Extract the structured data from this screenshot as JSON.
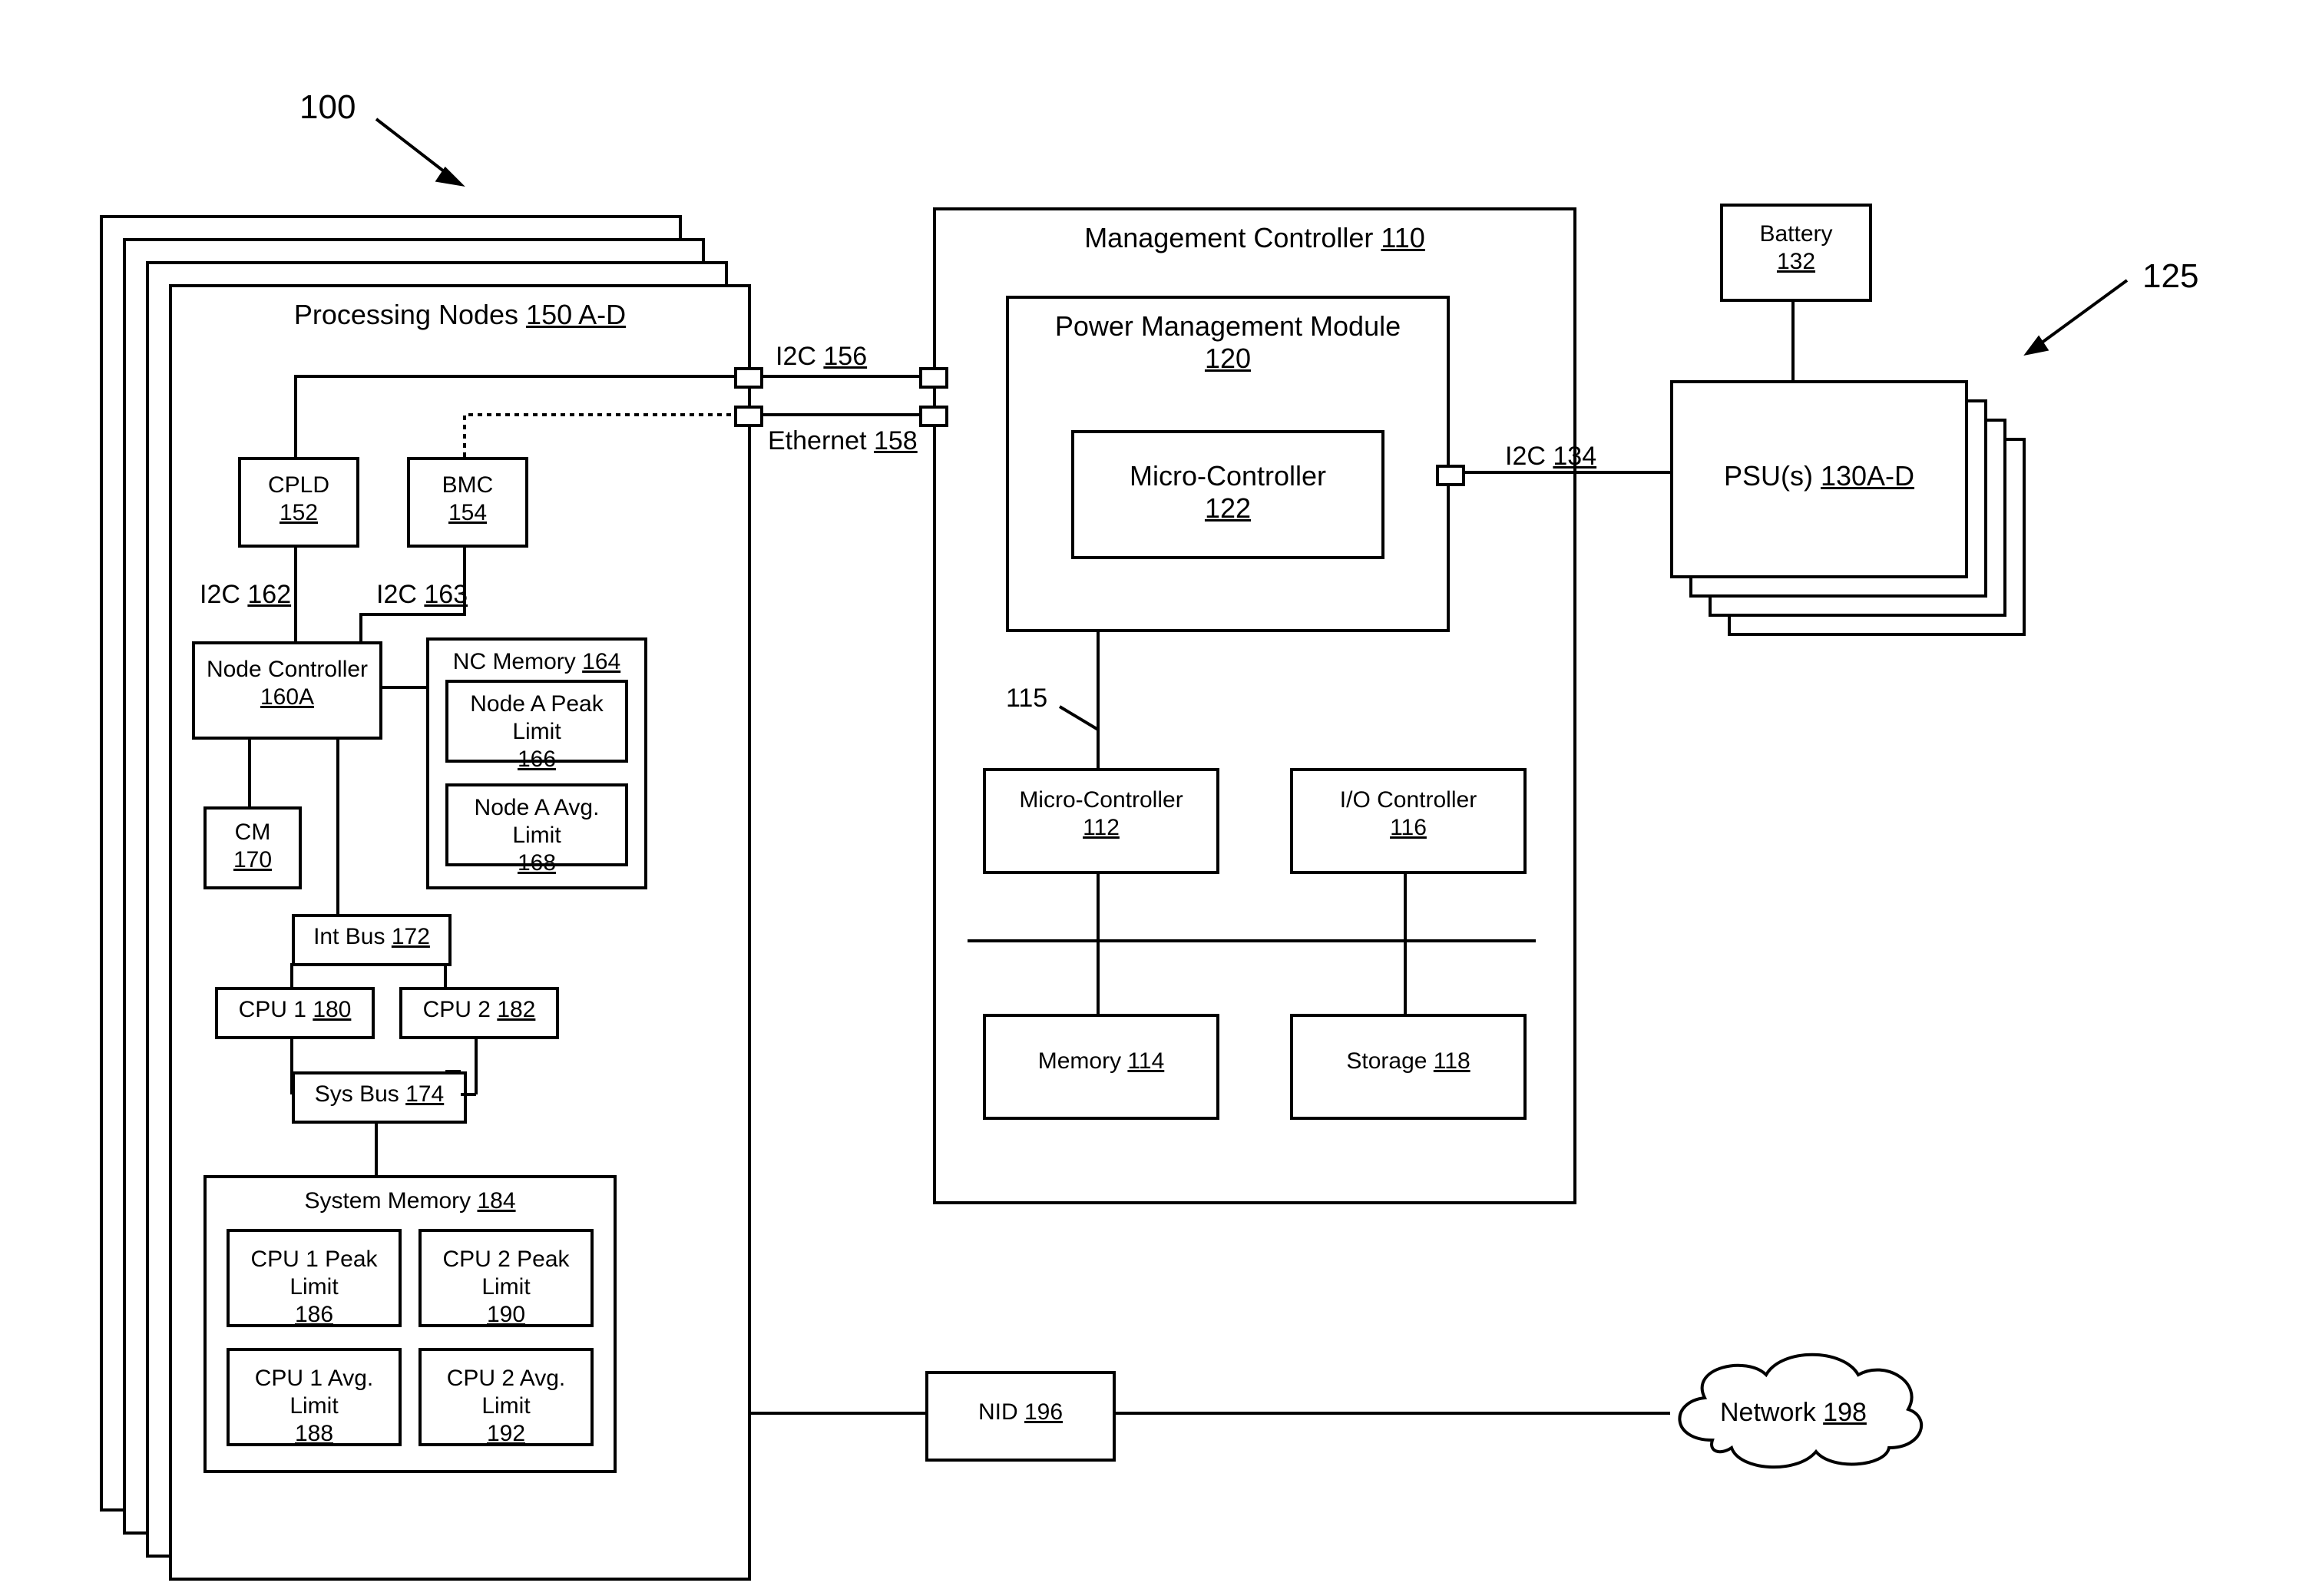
{
  "refs": {
    "system": "100",
    "psu_group": "125"
  },
  "processing_nodes": {
    "title": "Processing Nodes",
    "ref": "150 A-D",
    "cpld": {
      "name": "CPLD",
      "ref": "152"
    },
    "bmc": {
      "name": "BMC",
      "ref": "154"
    },
    "bus_i2c_out": {
      "name": "I2C",
      "ref": "156"
    },
    "bus_eth_out": {
      "name": "Ethernet",
      "ref": "158"
    },
    "nc": {
      "name": "Node Controller",
      "ref": "160A"
    },
    "i2c_cpld_nc": {
      "name": "I2C",
      "ref": "162"
    },
    "i2c_bmc_nc": {
      "name": "I2C",
      "ref": "163"
    },
    "nc_mem": {
      "title": "NC Memory",
      "ref": "164",
      "peak": {
        "name": "Node A Peak Limit",
        "ref": "166"
      },
      "avg": {
        "name": "Node A Avg. Limit",
        "ref": "168"
      }
    },
    "cm": {
      "name": "CM",
      "ref": "170"
    },
    "int_bus": {
      "name": "Int Bus",
      "ref": "172"
    },
    "sys_bus": {
      "name": "Sys Bus",
      "ref": "174"
    },
    "cpu1": {
      "name": "CPU 1",
      "ref": "180"
    },
    "cpu2": {
      "name": "CPU 2",
      "ref": "182"
    },
    "sys_mem": {
      "title": "System Memory",
      "ref": "184",
      "cpu1_peak": {
        "name": "CPU 1 Peak Limit",
        "ref": "186"
      },
      "cpu1_avg": {
        "name": "CPU 1 Avg. Limit",
        "ref": "188"
      },
      "cpu2_peak": {
        "name": "CPU 2 Peak Limit",
        "ref": "190"
      },
      "cpu2_avg": {
        "name": "CPU 2 Avg. Limit",
        "ref": "192"
      }
    }
  },
  "mgmt": {
    "title": "Management Controller",
    "ref": "110",
    "pm_module": {
      "title": "Power Management Module",
      "ref": "120"
    },
    "micro_in_pm": {
      "name": "Micro-Controller",
      "ref": "122"
    },
    "micro": {
      "name": "Micro-Controller",
      "ref": "112"
    },
    "io": {
      "name": "I/O Controller",
      "ref": "116"
    },
    "memory": {
      "name": "Memory",
      "ref": "114"
    },
    "storage": {
      "name": "Storage",
      "ref": "118"
    },
    "bus115": "115"
  },
  "power": {
    "battery": {
      "name": "Battery",
      "ref": "132"
    },
    "psu": {
      "name": "PSU(s)",
      "ref": "130A-D"
    },
    "i2c": {
      "name": "I2C",
      "ref": "134"
    }
  },
  "bottom": {
    "nid": {
      "name": "NID",
      "ref": "196"
    },
    "network": {
      "name": "Network",
      "ref": "198"
    }
  }
}
